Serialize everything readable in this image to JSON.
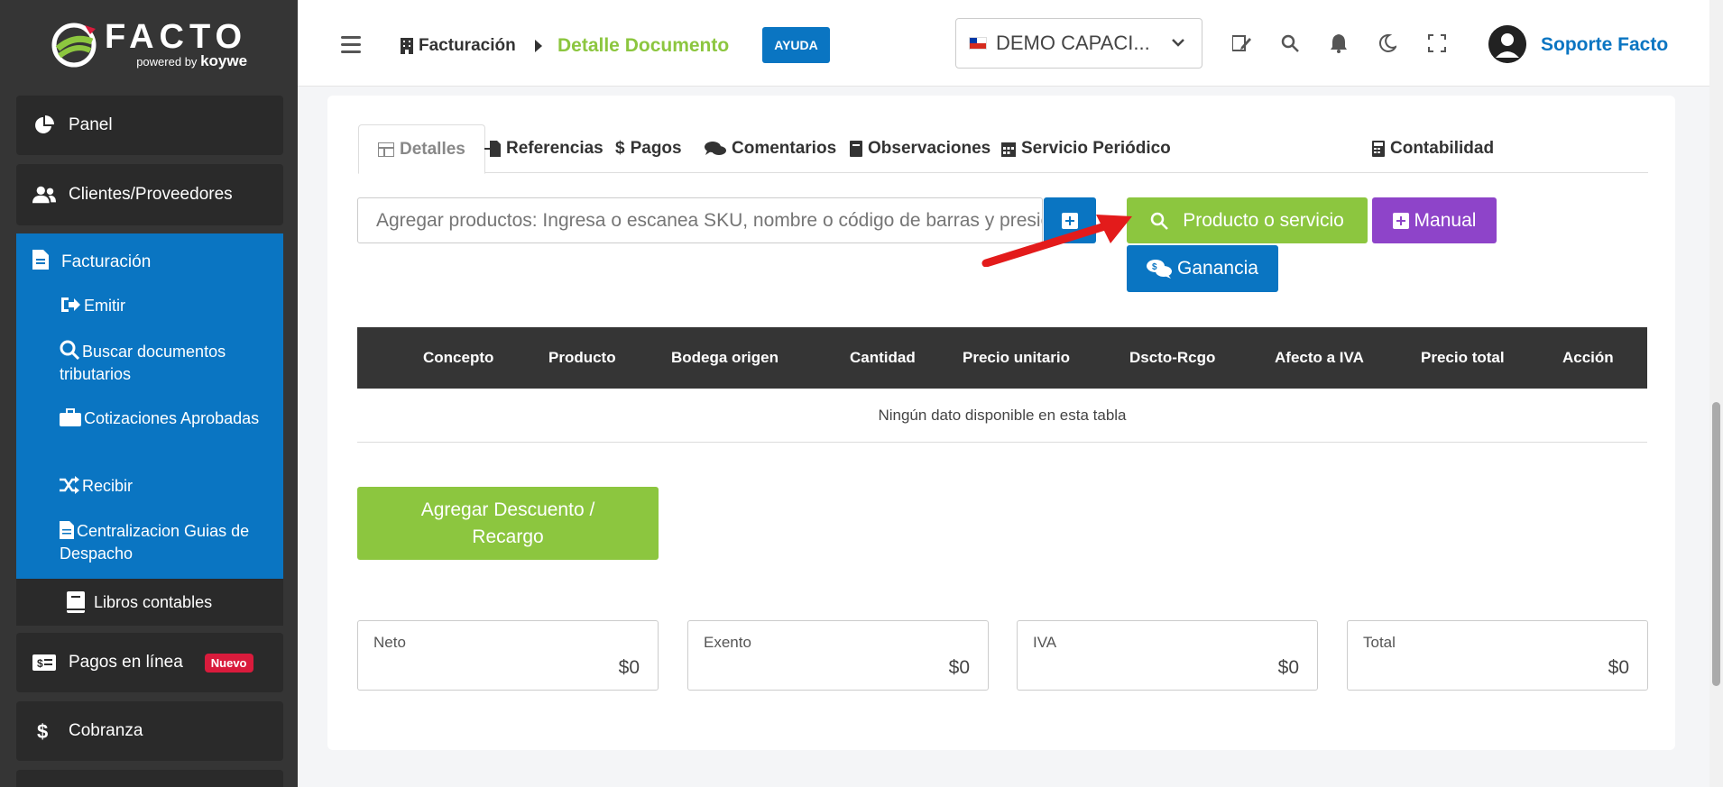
{
  "brand": {
    "name": "FACTO",
    "powered": "powered",
    "by": "by",
    "partner": "koywe"
  },
  "sidebar": {
    "items": [
      {
        "label": "Panel"
      },
      {
        "label": "Clientes/Proveedores"
      },
      {
        "label": "Facturación"
      },
      {
        "label": "Libros contables"
      },
      {
        "label": "Pagos en línea",
        "badge": "Nuevo"
      },
      {
        "label": "Cobranza"
      }
    ],
    "facturacion_sub": [
      {
        "label": "Emitir"
      },
      {
        "label": "Buscar documentos tributarios"
      },
      {
        "label": "Cotizaciones Aprobadas"
      },
      {
        "label": "Recibir"
      },
      {
        "label": "Centralizacion Guias de Despacho"
      }
    ]
  },
  "header": {
    "breadcrumb_parent": "Facturación",
    "breadcrumb_current": "Detalle Documento",
    "help_label": "AYUDA",
    "company": "DEMO CAPACI...",
    "user_name": "Soporte Facto"
  },
  "tabs": [
    {
      "label": "Detalles"
    },
    {
      "label": "Referencias"
    },
    {
      "label": "Pagos"
    },
    {
      "label": "Comentarios"
    },
    {
      "label": "Observaciones"
    },
    {
      "label": "Servicio Periódico"
    },
    {
      "label": "Contabilidad"
    }
  ],
  "product_search": {
    "placeholder": "Agregar productos: Ingresa o escanea SKU, nombre o código de barras y presiona enter"
  },
  "buttons": {
    "product_service": "Producto o servicio",
    "manual": "Manual",
    "ganancia": "Ganancia",
    "add_discount": "Agregar Descuento / Recargo"
  },
  "table": {
    "columns": [
      "Concepto",
      "Producto",
      "Bodega origen",
      "Cantidad",
      "Precio unitario",
      "Dscto-Rcgo",
      "Afecto a IVA",
      "Precio total",
      "Acción"
    ],
    "empty_message": "Ningún dato disponible en esta tabla"
  },
  "totals": [
    {
      "label": "Neto",
      "value": "$0"
    },
    {
      "label": "Exento",
      "value": "$0"
    },
    {
      "label": "IVA",
      "value": "$0"
    },
    {
      "label": "Total",
      "value": "$0"
    }
  ],
  "colors": {
    "primary_blue": "#0a75c2",
    "green": "#8cc63f",
    "purple": "#8e44c9",
    "sidebar": "#353535",
    "arrow_red": "#e31b1b"
  }
}
